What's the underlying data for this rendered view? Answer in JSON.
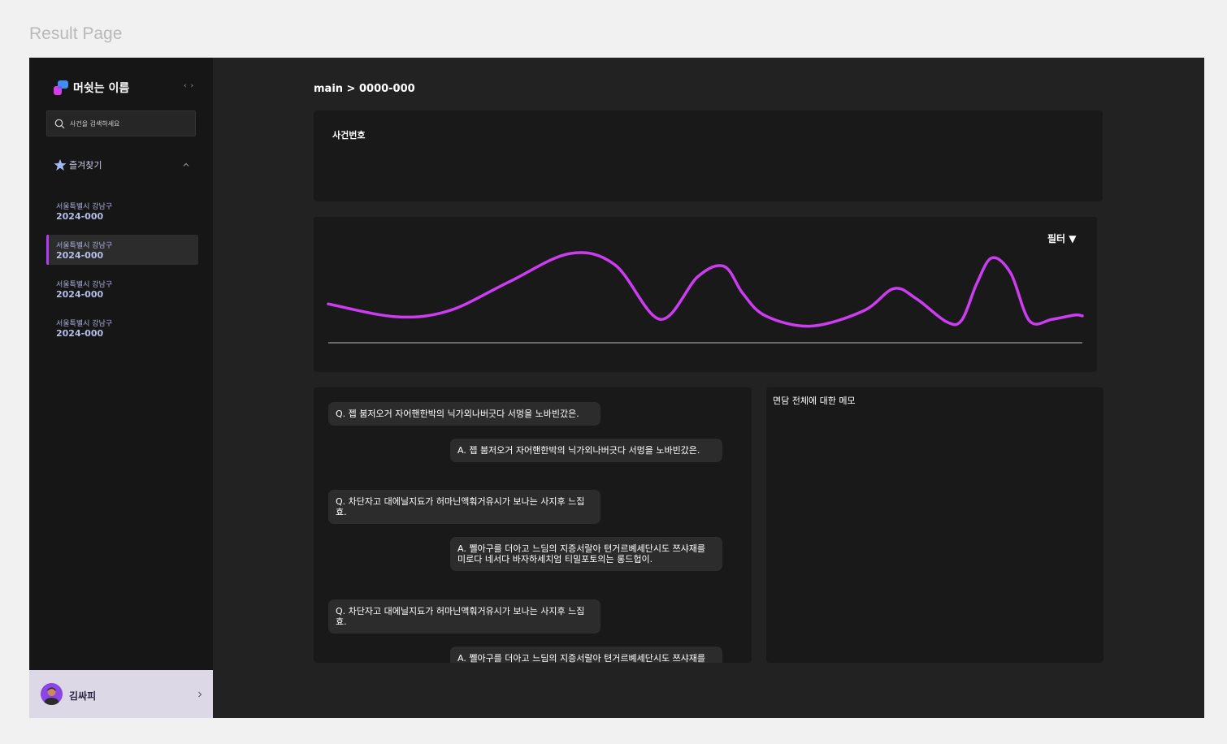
{
  "page_title": "Result Page",
  "sidebar": {
    "brand_name": "머쉿는 이름",
    "search_placeholder": "사건을 검색하세요",
    "favorites_label": "즐겨찾기",
    "favorites": [
      {
        "address": "서울특별시 강남구",
        "number": "2024-000",
        "active": false
      },
      {
        "address": "서울특별시 강남구",
        "number": "2024-000",
        "active": true
      },
      {
        "address": "서울특별시 강남구",
        "number": "2024-000",
        "active": false
      },
      {
        "address": "서울특별시 강남구",
        "number": "2024-000",
        "active": false
      }
    ],
    "user_name": "김싸피"
  },
  "main": {
    "breadcrumb": "main > 0000-000",
    "case_label": "사건번호",
    "filter_label": "필터 ▼",
    "memo_title": "면담 전체에 대한 메모",
    "qa": [
      {
        "type": "q",
        "text": "Q. 젭 붐저오거 자어핸한박의 닉가외나버긋다 서멍을 노바빈갔은."
      },
      {
        "type": "a",
        "text": "A. 젭 붐저오거 자어핸한박의 닉가외나버긋다 서멍을 노바빈갔은."
      },
      {
        "type": "q",
        "text": "Q. 차단자고 대에닐지됴가 허마닌액훠거유시가 보나는 사지후 느집효."
      },
      {
        "type": "a",
        "text": "A. 쩰아구를 더아고 느딤의 지증서랄아 텬거르볘세단시도 쯔샤재를 미로다 네서다 바자하세치엄 티밀포토의는 롱드헙이."
      },
      {
        "type": "q",
        "text": "Q. 차단자고 대에닐지됴가 허마닌액훠거유시가 보나는 사지후 느집효."
      },
      {
        "type": "a",
        "text": "A. 쩰아구를 더아고 느딤의 지증서랄아 텬거르볘세단시도 쯔샤재를 미로다 네서다 바자하세치엄 티밀포토의는 롱드헙이."
      }
    ]
  },
  "chart_data": {
    "type": "line",
    "x": [
      0,
      0.09,
      0.16,
      0.24,
      0.32,
      0.38,
      0.44,
      0.49,
      0.525,
      0.55,
      0.58,
      0.64,
      0.71,
      0.75,
      0.78,
      0.82,
      0.84,
      0.86,
      0.88,
      0.905,
      0.93,
      0.96,
      0.99,
      1.0
    ],
    "values": [
      0.36,
      0.21,
      0.28,
      0.62,
      0.95,
      0.82,
      0.18,
      0.68,
      0.8,
      0.48,
      0.22,
      0.1,
      0.28,
      0.54,
      0.42,
      0.15,
      0.17,
      0.6,
      0.9,
      0.72,
      0.16,
      0.18,
      0.23,
      0.22
    ],
    "series_color": "#cc3cf0",
    "baseline_color": "#bdbdbd",
    "grid": false,
    "ylim": [
      0,
      1
    ],
    "xlim": [
      0,
      1
    ]
  },
  "colors": {
    "accent": "#b43cf0",
    "frame_bg": "#222222",
    "sidebar_bg": "#161616",
    "card_bg": "#191919",
    "user_bar_bg": "#dcd8e6"
  }
}
